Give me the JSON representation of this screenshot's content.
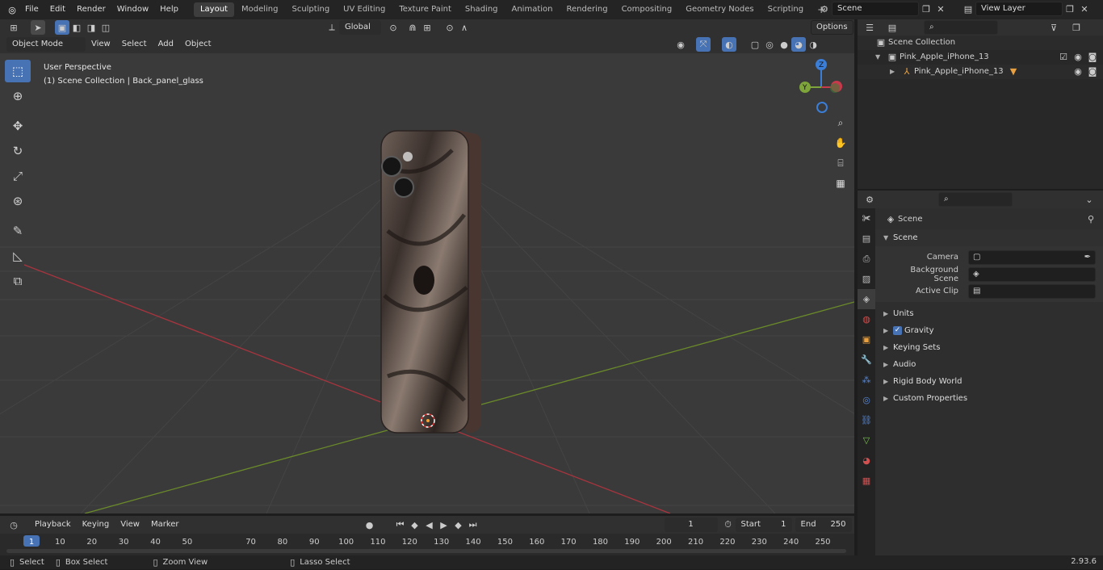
{
  "topbar": {
    "menus": [
      "File",
      "Edit",
      "Render",
      "Window",
      "Help"
    ],
    "workspaces": [
      "Layout",
      "Modeling",
      "Sculpting",
      "UV Editing",
      "Texture Paint",
      "Shading",
      "Animation",
      "Rendering",
      "Compositing",
      "Geometry Nodes",
      "Scripting"
    ],
    "active_workspace": "Layout",
    "scene": "Scene",
    "view_layer": "View Layer"
  },
  "viewport": {
    "transform": "Global",
    "options": "Options",
    "mode": "Object Mode",
    "menus": [
      "View",
      "Select",
      "Add",
      "Object"
    ],
    "view_name": "User Perspective",
    "context": "(1) Scene Collection | Back_panel_glass",
    "gizmo": {
      "z": "Z",
      "y": "Y"
    }
  },
  "outliner": {
    "root": "Scene Collection",
    "collection": "Pink_Apple_iPhone_13",
    "object": "Pink_Apple_iPhone_13"
  },
  "properties": {
    "context": "Scene",
    "panel": "Scene",
    "fields": [
      {
        "label": "Camera",
        "value": ""
      },
      {
        "label": "Background Scene",
        "value": ""
      },
      {
        "label": "Active Clip",
        "value": ""
      }
    ],
    "subpanels": [
      "Units",
      "Gravity",
      "Keying Sets",
      "Audio",
      "Rigid Body World",
      "Custom Properties"
    ]
  },
  "timeline": {
    "menus": [
      "Playback",
      "Keying",
      "View",
      "Marker"
    ],
    "current_frame": "1",
    "start_label": "Start",
    "start": "1",
    "end_label": "End",
    "end": "250",
    "ticks": [
      "1",
      "10",
      "20",
      "30",
      "40",
      "50",
      "70",
      "80",
      "90",
      "100",
      "110",
      "120",
      "130",
      "140",
      "150",
      "160",
      "170",
      "180",
      "190",
      "200",
      "210",
      "220",
      "230",
      "240",
      "250"
    ]
  },
  "status": {
    "select": "Select",
    "box_select": "Box Select",
    "zoom_view": "Zoom View",
    "lasso_select": "Lasso Select",
    "version": "2.93.6"
  }
}
